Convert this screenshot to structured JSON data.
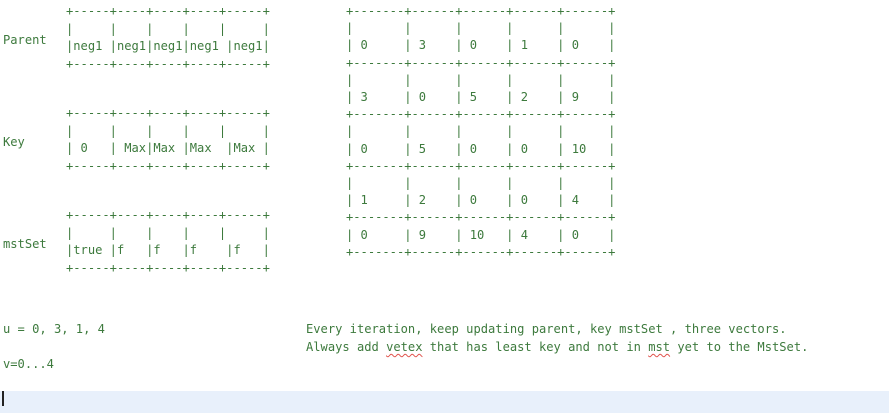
{
  "labels": {
    "parent": "Parent",
    "key": "Key",
    "mstset": "mstSet"
  },
  "tables": {
    "parent_table": "+-----+----+----+----+-----+\n|     |    |    |    |     |\n|neg1 |neg1|neg1|neg1 |neg1|\n+-----+----+----+----+-----+",
    "key_table": "+-----+----+----+----+-----+\n|     |    |    |    |     |\n| 0   | Max|Max |Max  |Max |\n+-----+----+----+----+-----+",
    "mstset_table": "+-----+----+----+----+-----+\n|     |    |    |    |     |\n|true |f   |f   |f    |f   |\n+-----+----+----+----+-----+",
    "right_table": "+-------+------+------+------+------+\n|       |      |      |      |      |\n| 0     | 3    | 0    | 1    | 0    |\n+-------+------+------+------+------+\n|       |      |      |      |      |\n| 3     | 0    | 5    | 2    | 9    |\n+-------+------+------+------+------+\n|       |      |      |      |      |\n| 0     | 5    | 0    | 0    | 10   |\n+-------+------+------+------+------+\n|       |      |      |      |      |\n| 1     | 2    | 0    | 0    | 4    |\n+-------+------+------+------+------+\n| 0     | 9    | 10   | 4    | 0    |\n+-------+------+------+------+------+"
  },
  "notes": {
    "u_line": "u = 0, 3, 1, 4",
    "v_line": "v=0...4",
    "note1": "Every iteration, keep updating parent, key mstSet , three vectors.",
    "note2_a": "Always add ",
    "note2_b": "vetex",
    "note2_c": " that has least key and not in ",
    "note2_d": "mst",
    "note2_e": " yet to the MstSet."
  }
}
